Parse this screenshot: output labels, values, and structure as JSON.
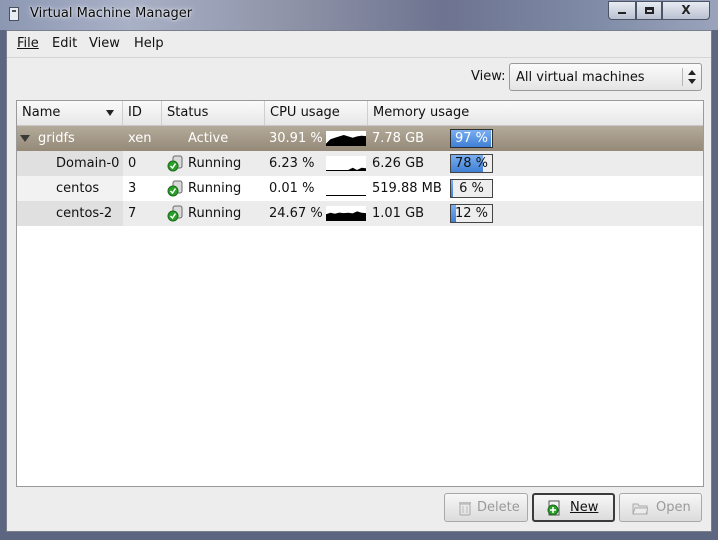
{
  "window": {
    "title": "Virtual Machine Manager",
    "controls": {
      "minimize": "",
      "maximize": "",
      "close": "X"
    }
  },
  "menubar": {
    "items": [
      "File",
      "Edit",
      "View",
      "Help"
    ]
  },
  "view_filter": {
    "label": "View:",
    "selected": "All virtual machines"
  },
  "table": {
    "columns": [
      "Name",
      "ID",
      "Status",
      "CPU usage",
      "Memory usage"
    ],
    "rows": [
      {
        "name": "gridfs",
        "id": "xen",
        "status": "Active",
        "cpu": "30.91 %",
        "mem": "7.78 GB",
        "mem_pct_label": "97 %",
        "mem_fraction": 0.97,
        "cpu_history": [
          0.05,
          0.2,
          0.25,
          0.3,
          0.35,
          0.3,
          0.25,
          0.3,
          0.32,
          0.31
        ]
      },
      {
        "name": "Domain-0",
        "id": "0",
        "status": "Running",
        "cpu": "6.23 %",
        "mem": "6.26 GB",
        "mem_pct_label": "78 %",
        "mem_fraction": 0.78,
        "cpu_history": [
          0,
          0,
          0,
          0,
          0,
          0,
          0.08,
          0,
          0.08,
          0.06
        ]
      },
      {
        "name": "centos",
        "id": "3",
        "status": "Running",
        "cpu": "0.01 %",
        "mem": "519.88 MB",
        "mem_pct_label": "6 %",
        "mem_fraction": 0.06,
        "cpu_history": [
          0,
          0,
          0,
          0,
          0,
          0,
          0,
          0,
          0,
          0
        ]
      },
      {
        "name": "centos-2",
        "id": "7",
        "status": "Running",
        "cpu": "24.67 %",
        "mem": "1.01 GB",
        "mem_pct_label": "12 %",
        "mem_fraction": 0.12,
        "cpu_history": [
          0.2,
          0.25,
          0.22,
          0.26,
          0.24,
          0.25,
          0.23,
          0.3,
          0.25,
          0.24
        ]
      }
    ]
  },
  "buttons": {
    "delete": "Delete",
    "new": "New",
    "open": "Open"
  },
  "colors": {
    "group_row": "#a69b89",
    "mem_fill": "#4a8be0",
    "run_ok": "#2aa02a"
  }
}
